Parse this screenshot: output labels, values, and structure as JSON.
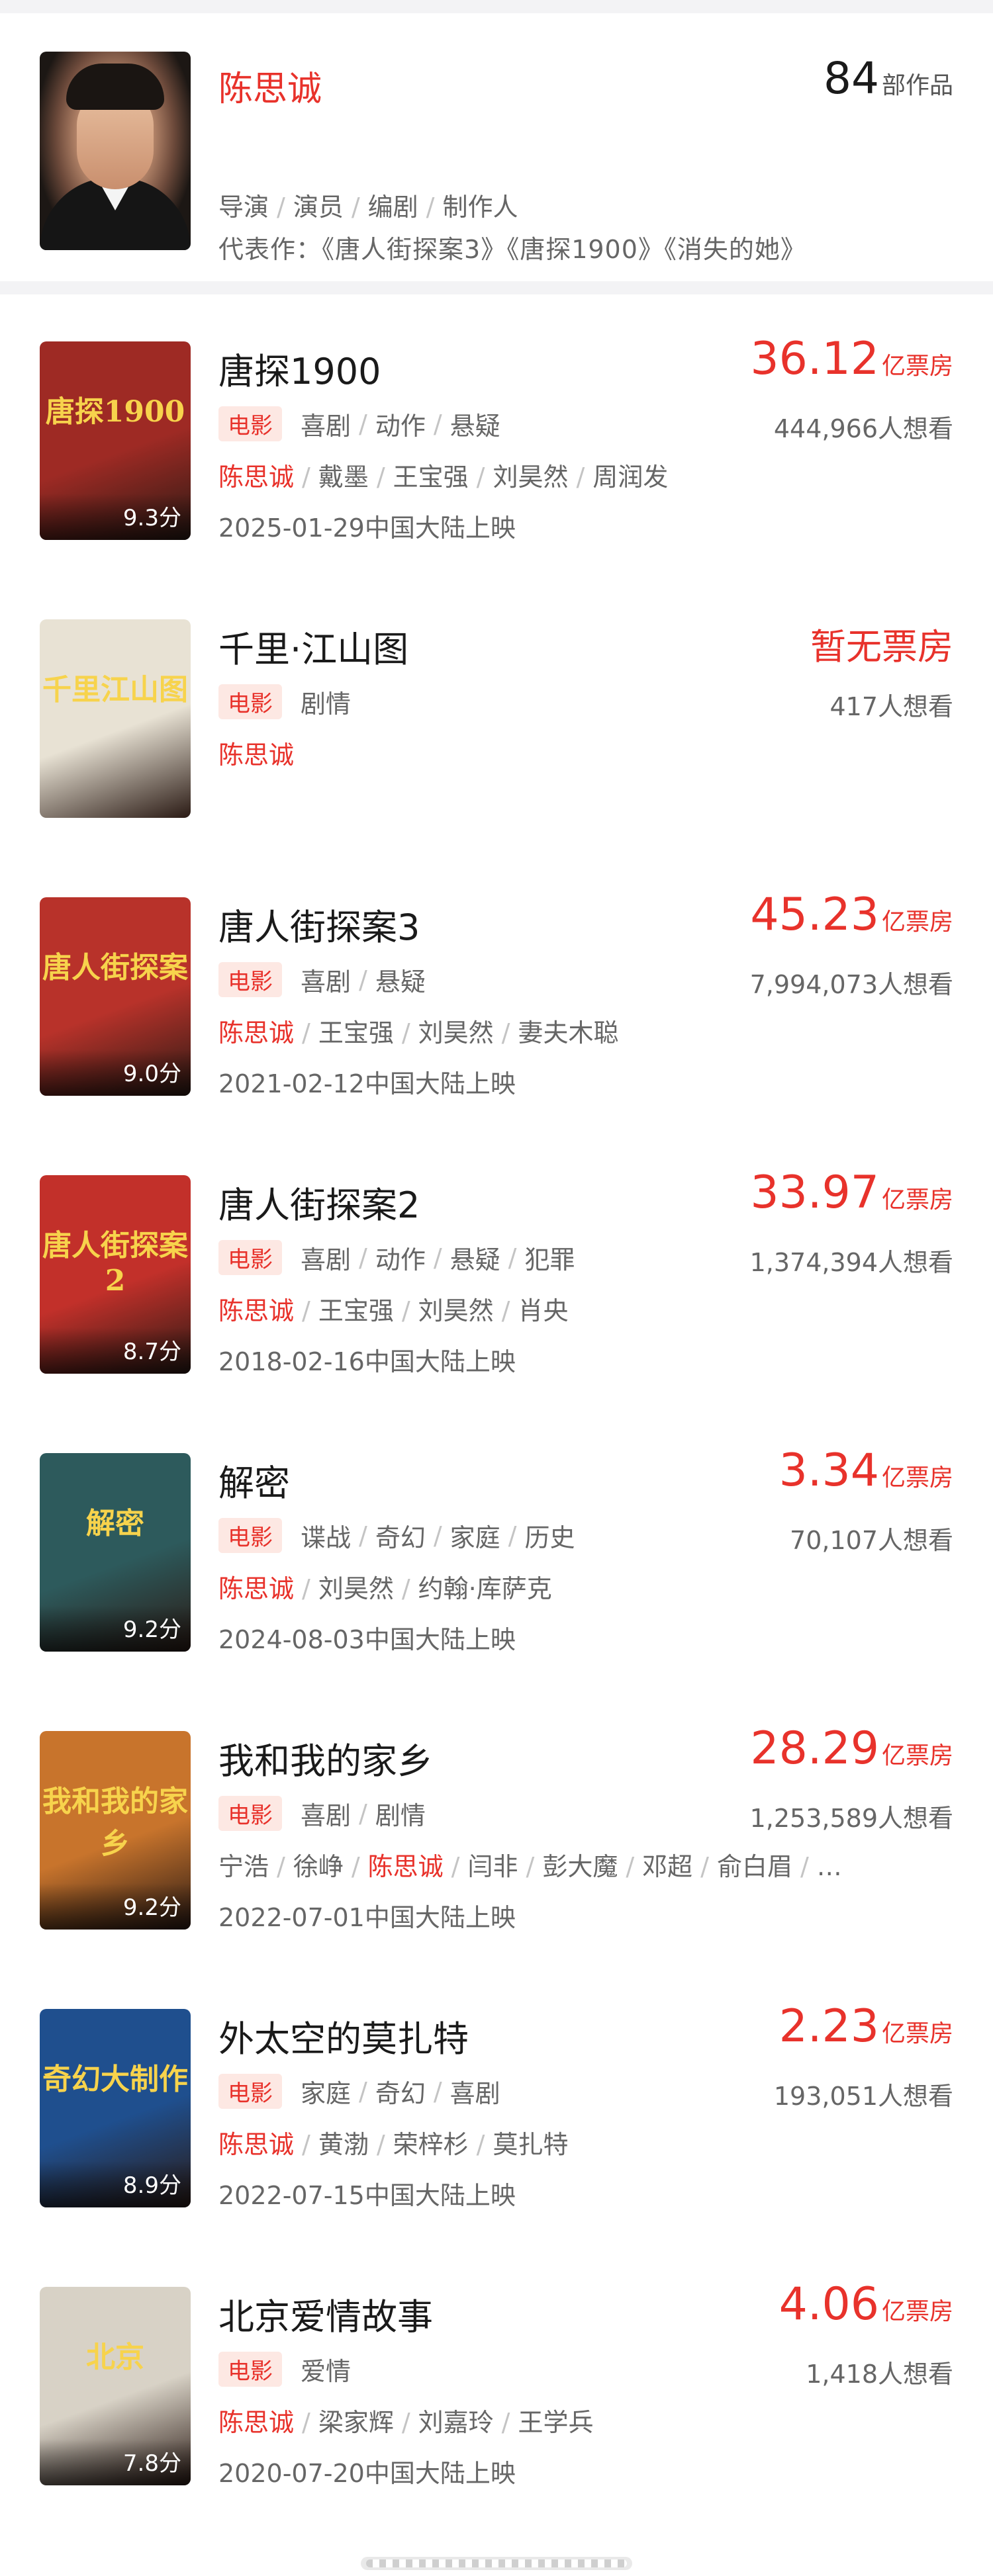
{
  "person": {
    "name": "陈思诚",
    "count": "84",
    "count_unit": "部作品",
    "roles": [
      "导演",
      "演员",
      "编剧",
      "制作人"
    ],
    "works_label": "代表作：",
    "works": "《唐人街探案3》《唐探1900》《消失的她》"
  },
  "movies": [
    {
      "title": "唐探1900",
      "poster_text": "唐探1900",
      "score": "9.3分",
      "box_value": "36.12",
      "box_unit": "亿票房",
      "type": "电影",
      "genres": [
        "喜剧",
        "动作",
        "悬疑"
      ],
      "want": "444,966人想看",
      "cast": [
        "陈思诚",
        "戴墨",
        "王宝强",
        "刘昊然",
        "周润发"
      ],
      "release": "2025-01-29中国大陆上映",
      "poster_color": "#9e2a24"
    },
    {
      "title": "千里·江山图",
      "poster_text": "千里江山图",
      "score": "",
      "box_none": "暂无票房",
      "type": "电影",
      "genres": [
        "剧情"
      ],
      "want": "417人想看",
      "cast": [
        "陈思诚"
      ],
      "release": "",
      "poster_color": "#e8e2d4"
    },
    {
      "title": "唐人街探案3",
      "poster_text": "唐人街探案",
      "score": "9.0分",
      "box_value": "45.23",
      "box_unit": "亿票房",
      "type": "电影",
      "genres": [
        "喜剧",
        "悬疑"
      ],
      "want": "7,994,073人想看",
      "cast": [
        "陈思诚",
        "王宝强",
        "刘昊然",
        "妻夫木聪"
      ],
      "release": "2021-02-12中国大陆上映",
      "poster_color": "#b8322a"
    },
    {
      "title": "唐人街探案2",
      "poster_text": "唐人街探案2",
      "score": "8.7分",
      "box_value": "33.97",
      "box_unit": "亿票房",
      "type": "电影",
      "genres": [
        "喜剧",
        "动作",
        "悬疑",
        "犯罪"
      ],
      "want": "1,374,394人想看",
      "cast": [
        "陈思诚",
        "王宝强",
        "刘昊然",
        "肖央"
      ],
      "release": "2018-02-16中国大陆上映",
      "poster_color": "#c2302a"
    },
    {
      "title": "解密",
      "poster_text": "解密",
      "score": "9.2分",
      "box_value": "3.34",
      "box_unit": "亿票房",
      "type": "电影",
      "genres": [
        "谍战",
        "奇幻",
        "家庭",
        "历史"
      ],
      "want": "70,107人想看",
      "cast": [
        "陈思诚",
        "刘昊然",
        "约翰·库萨克"
      ],
      "release": "2024-08-03中国大陆上映",
      "poster_color": "#2d5a5c"
    },
    {
      "title": "我和我的家乡",
      "poster_text": "我和我的家乡",
      "score": "9.2分",
      "box_value": "28.29",
      "box_unit": "亿票房",
      "type": "电影",
      "genres": [
        "喜剧",
        "剧情"
      ],
      "want": "1,253,589人想看",
      "cast": [
        "宁浩",
        "徐峥",
        "陈思诚",
        "闫非",
        "彭大魔",
        "邓超",
        "俞白眉",
        "…"
      ],
      "release": "2022-07-01中国大陆上映",
      "poster_color": "#c8742c"
    },
    {
      "title": "外太空的莫扎特",
      "poster_text": "奇幻大制作",
      "score": "8.9分",
      "box_value": "2.23",
      "box_unit": "亿票房",
      "type": "电影",
      "genres": [
        "家庭",
        "奇幻",
        "喜剧"
      ],
      "want": "193,051人想看",
      "cast": [
        "陈思诚",
        "黄渤",
        "荣梓杉",
        "莫扎特"
      ],
      "release": "2022-07-15中国大陆上映",
      "poster_color": "#1f4f8e"
    },
    {
      "title": "北京爱情故事",
      "poster_text": "北京",
      "score": "7.8分",
      "box_value": "4.06",
      "box_unit": "亿票房",
      "type": "电影",
      "genres": [
        "爱情"
      ],
      "want": "1,418人想看",
      "cast": [
        "陈思诚",
        "梁家辉",
        "刘嘉玲",
        "王学兵"
      ],
      "release": "2020-07-20中国大陆上映",
      "poster_color": "#d8d2c6"
    }
  ]
}
